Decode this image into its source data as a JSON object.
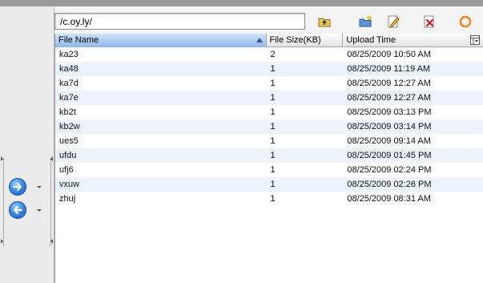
{
  "toolbar": {
    "path_value": "/c.oy.ly/",
    "buttons": [
      {
        "name": "up-folder",
        "icon": "folder-up-icon"
      },
      {
        "name": "new-folder",
        "icon": "new-folder-icon"
      },
      {
        "name": "rename",
        "icon": "edit-icon"
      },
      {
        "name": "delete",
        "icon": "delete-icon"
      },
      {
        "name": "refresh",
        "icon": "refresh-icon"
      }
    ]
  },
  "nav": {
    "forward_icon": "arrow-right-icon",
    "back_icon": "arrow-left-icon"
  },
  "table": {
    "columns": [
      "File Name",
      "File Size(KB)",
      "Upload Time"
    ],
    "sort": {
      "column": "File Name",
      "direction": "ascending"
    },
    "rows": [
      [
        "ka23",
        "2",
        "08/25/2009 10:50 AM"
      ],
      [
        "ka48",
        "1",
        "08/25/2009 11:19 AM"
      ],
      [
        "ka7d",
        "1",
        "08/25/2009 12:27 AM"
      ],
      [
        "ka7e",
        "1",
        "08/25/2009 12:27 AM"
      ],
      [
        "kb2t",
        "1",
        "08/25/2009 03:13 PM"
      ],
      [
        "kb2w",
        "1",
        "08/25/2009 03:14 PM"
      ],
      [
        "ues5",
        "1",
        "08/25/2009 09:14 AM"
      ],
      [
        "ufdu",
        "1",
        "08/25/2009 01:45 PM"
      ],
      [
        "ufj6",
        "1",
        "08/25/2009 02:24 PM"
      ],
      [
        "vxuw",
        "1",
        "08/25/2009 02:26 PM"
      ],
      [
        "zhuj",
        "1",
        "08/25/2009 08:31 AM"
      ]
    ]
  },
  "colors": {
    "accent": "#3a8ce8",
    "sorted_header": "#8fb7ea",
    "row_stripe": "#edf3fd"
  }
}
